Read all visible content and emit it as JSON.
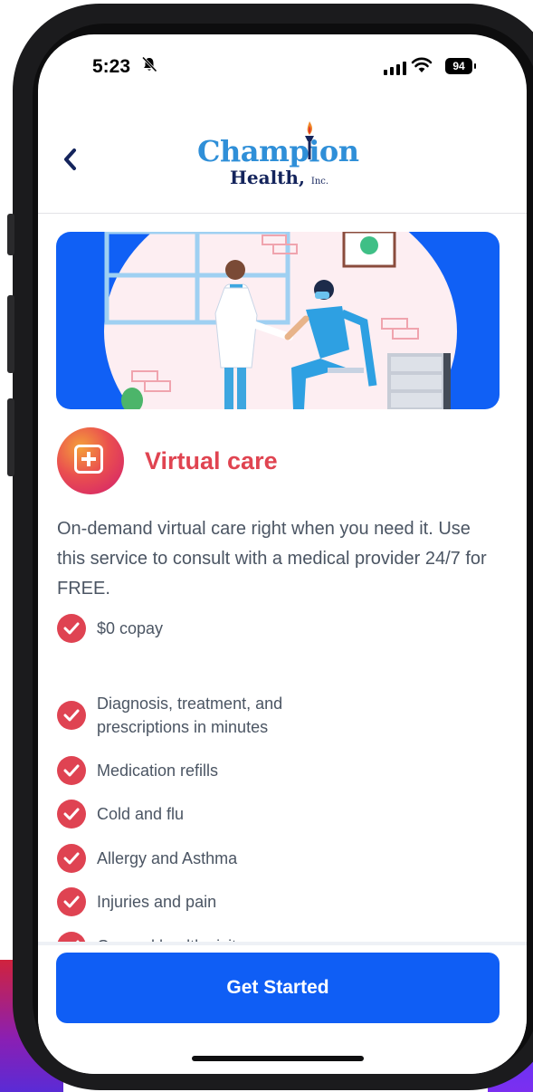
{
  "status_bar": {
    "time": "5:23",
    "battery": "94"
  },
  "header": {
    "logo_line1": "Champion",
    "logo_line2": "Health,",
    "logo_inc": "Inc."
  },
  "service": {
    "title": "Virtual care",
    "description": "On-demand virtual care right when you need it. Use this service to consult with a medical provider 24/7 for FREE.",
    "benefits": [
      "$0 copay",
      "Diagnosis, treatment, and prescriptions in minutes",
      "Medication refills",
      "Cold and flu",
      "Allergy and Asthma",
      "Injuries and pain",
      "General health visits"
    ]
  },
  "footer": {
    "cta_label": "Get Started"
  },
  "colors": {
    "primary_blue": "#0f5ef5",
    "accent_red": "#e04451",
    "text_gray": "#4b5563",
    "logo_blue": "#2f8fd8",
    "logo_navy": "#14245c"
  }
}
